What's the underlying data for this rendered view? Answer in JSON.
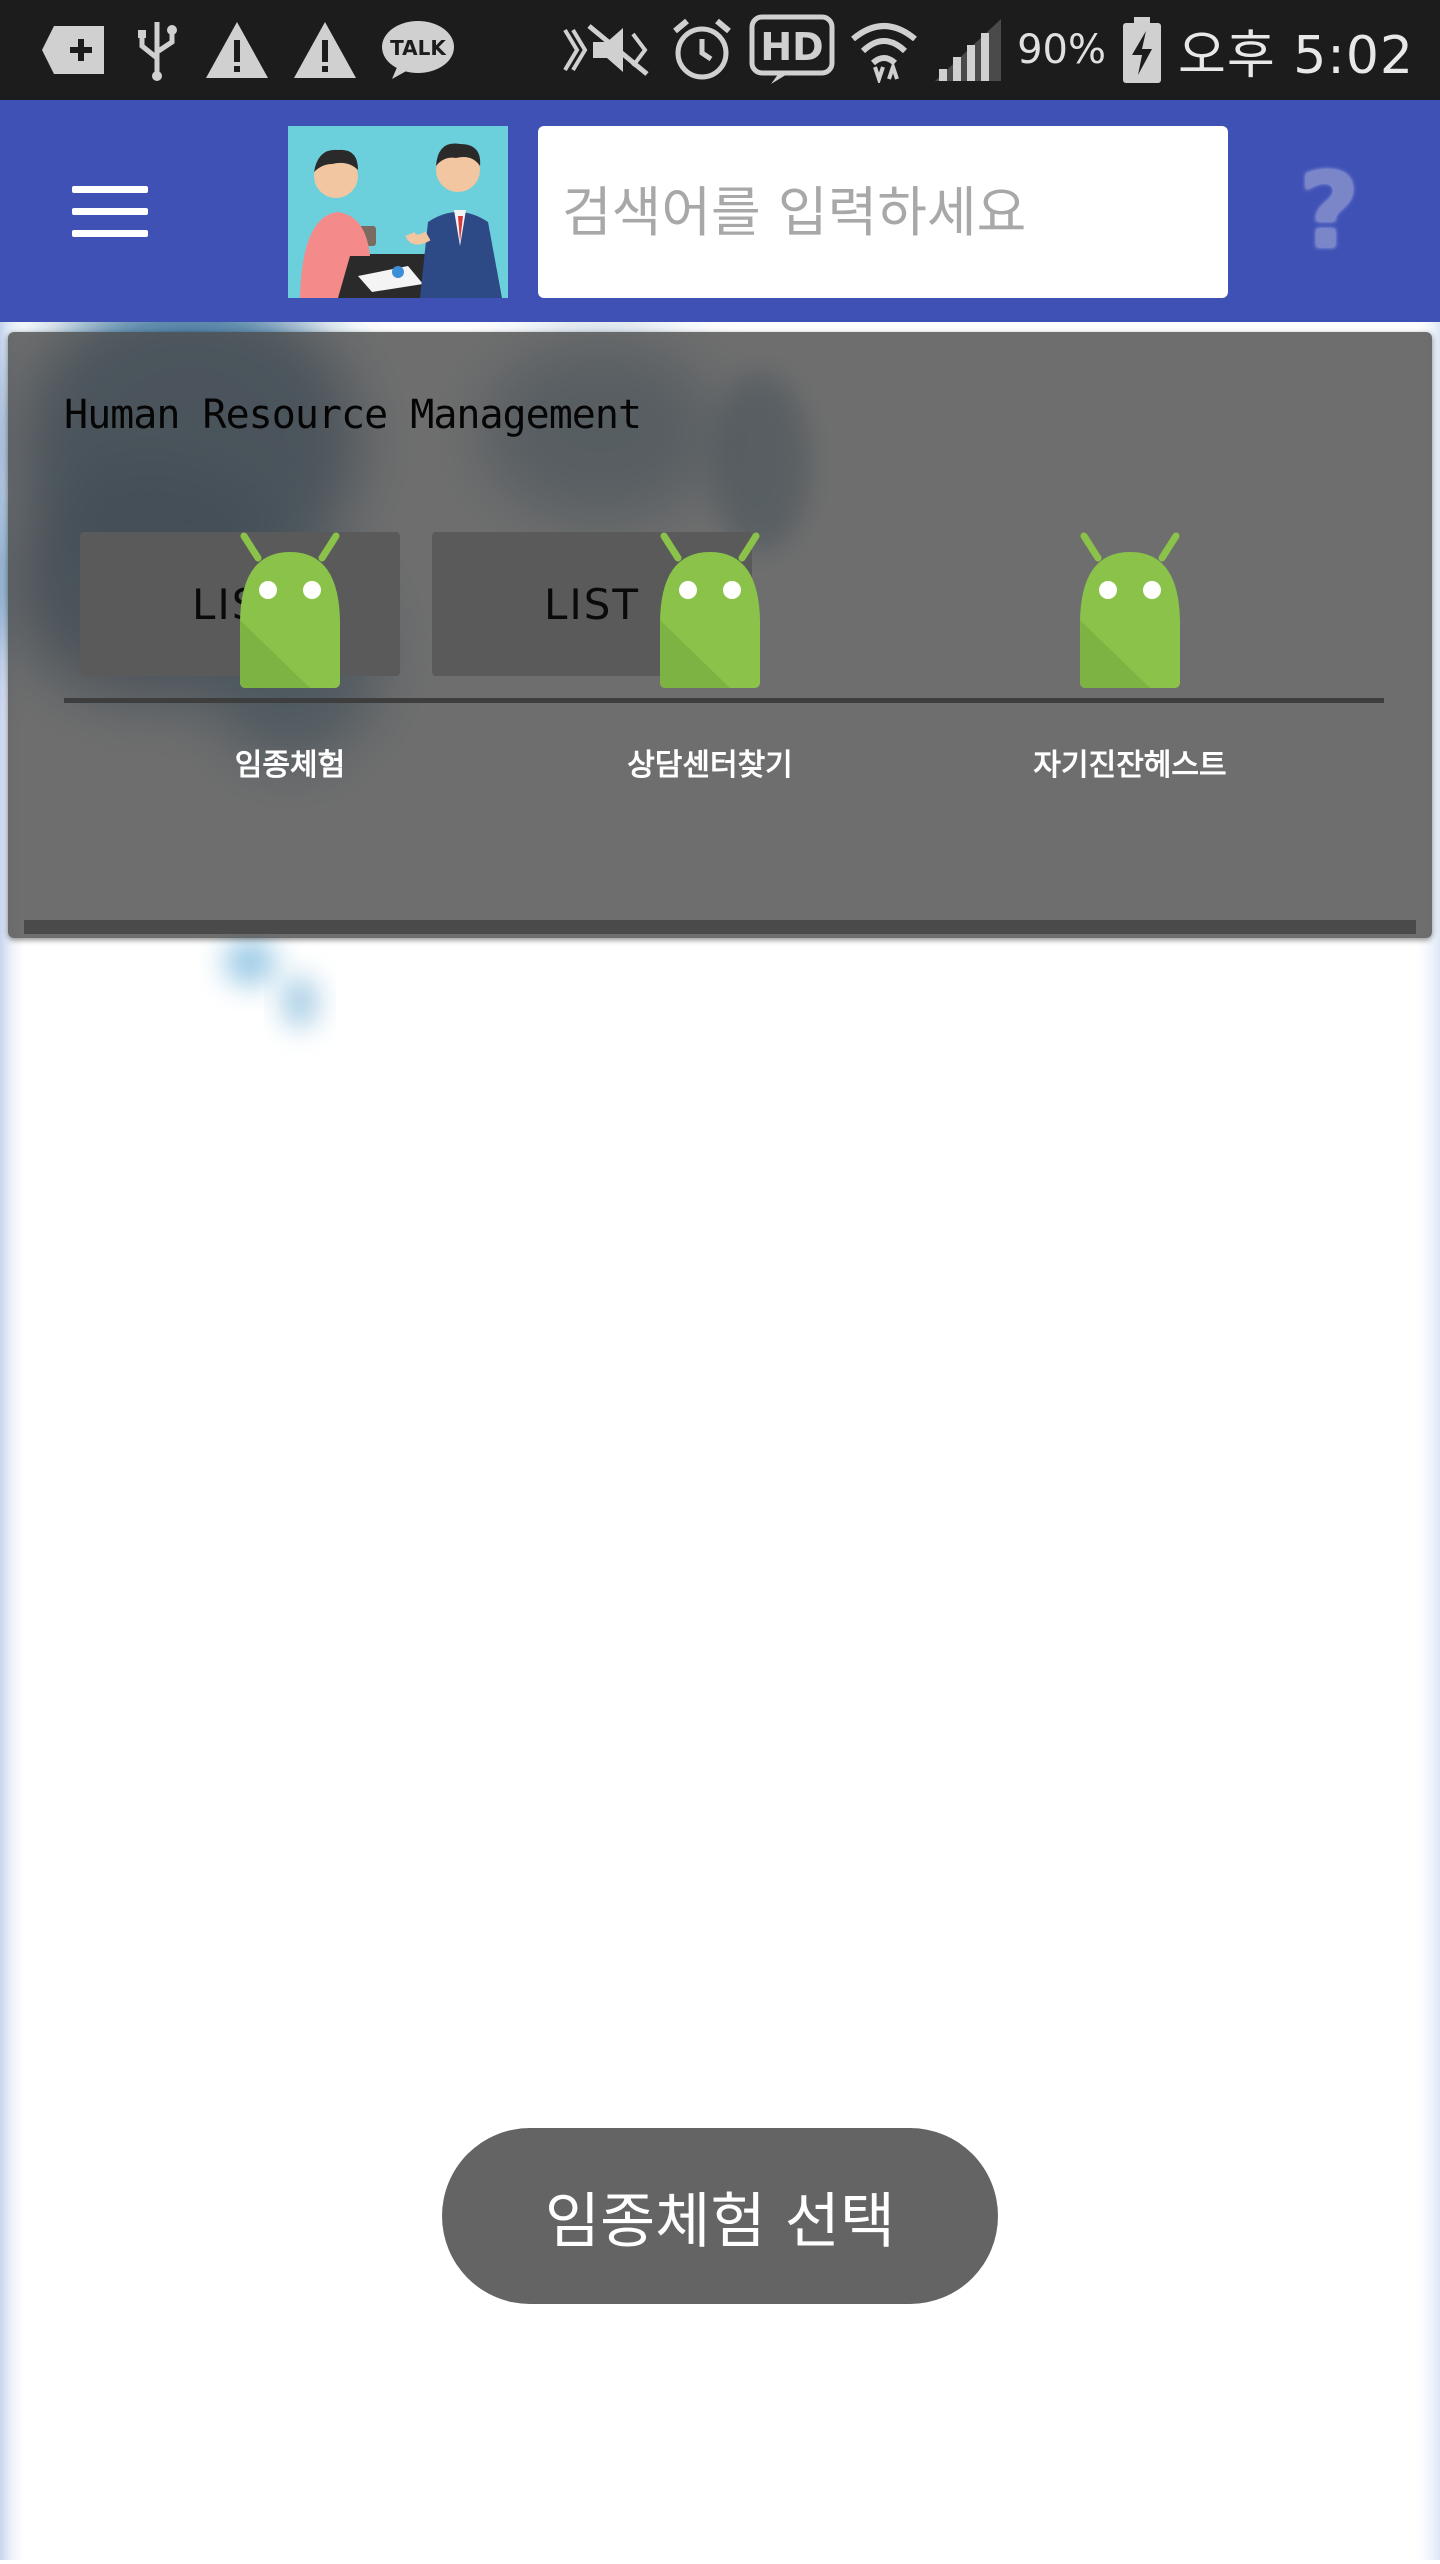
{
  "status_bar": {
    "battery": "90%",
    "time": "오후 5:02",
    "icons": [
      "add-box-icon",
      "usb-icon",
      "warning-icon",
      "warning-icon",
      "kakao-talk-icon",
      "mute-icon",
      "alarm-icon",
      "hd-icon",
      "wifi-icon",
      "signal-icon",
      "battery-charging-icon"
    ]
  },
  "app_bar": {
    "search_placeholder": "검색어를 입력하세요",
    "help_label": "?"
  },
  "panel": {
    "title": "Human Resource Management",
    "list_buttons": [
      "LIST",
      "LIST"
    ],
    "items": [
      {
        "label": "임종체험"
      },
      {
        "label": "상담센터찾기"
      },
      {
        "label": "자기진잔헤스트"
      }
    ]
  },
  "toast": {
    "message": "임종체험 선택"
  },
  "colors": {
    "app_bar": "#3f51b5",
    "android_green": "#8bc34a",
    "status_bar": "#1c1c1c"
  }
}
